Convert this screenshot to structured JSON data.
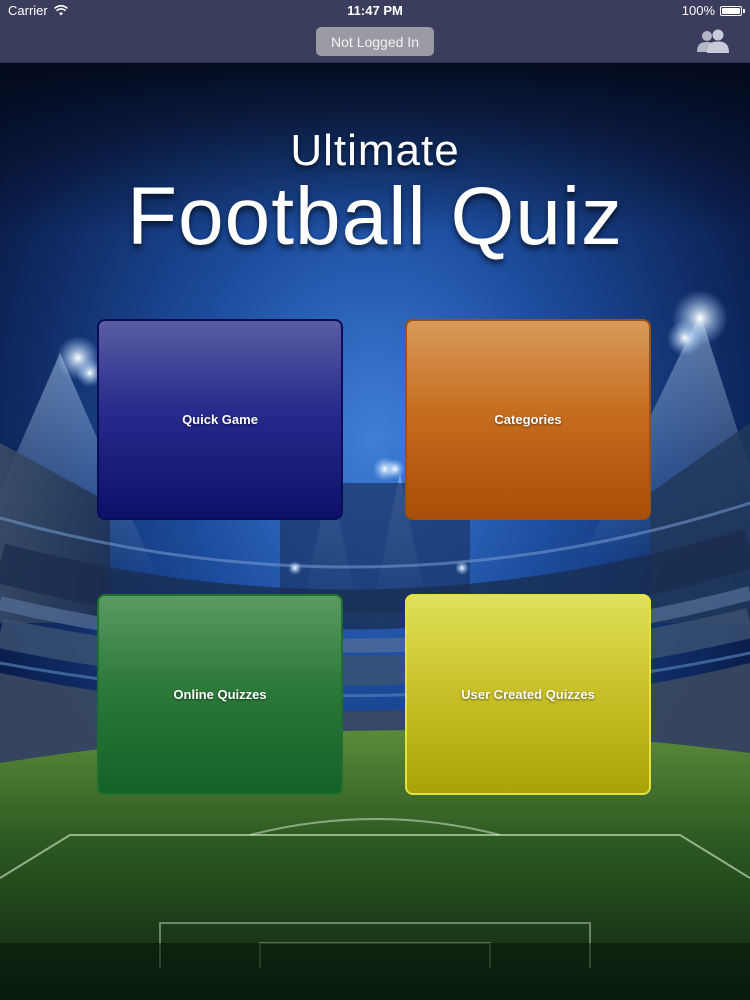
{
  "status_bar": {
    "carrier": "Carrier",
    "time": "11:47 PM",
    "battery": "100%",
    "battery_level": 1.0
  },
  "nav_bar": {
    "login_status": "Not Logged In",
    "users_icon": "users-icon"
  },
  "title": {
    "line1": "Ultimate",
    "line2": "Football Quiz"
  },
  "menu": {
    "quick_game": "Quick Game",
    "categories": "Categories",
    "online_quizzes": "Online Quizzes",
    "user_created_quizzes": "User Created Quizzes"
  },
  "colors": {
    "bar": "#3a3d5c",
    "quick_game": "#1b1e80",
    "categories": "#c26818",
    "online_quizzes": "#247030",
    "user_created_quizzes": "#c4bd20"
  }
}
